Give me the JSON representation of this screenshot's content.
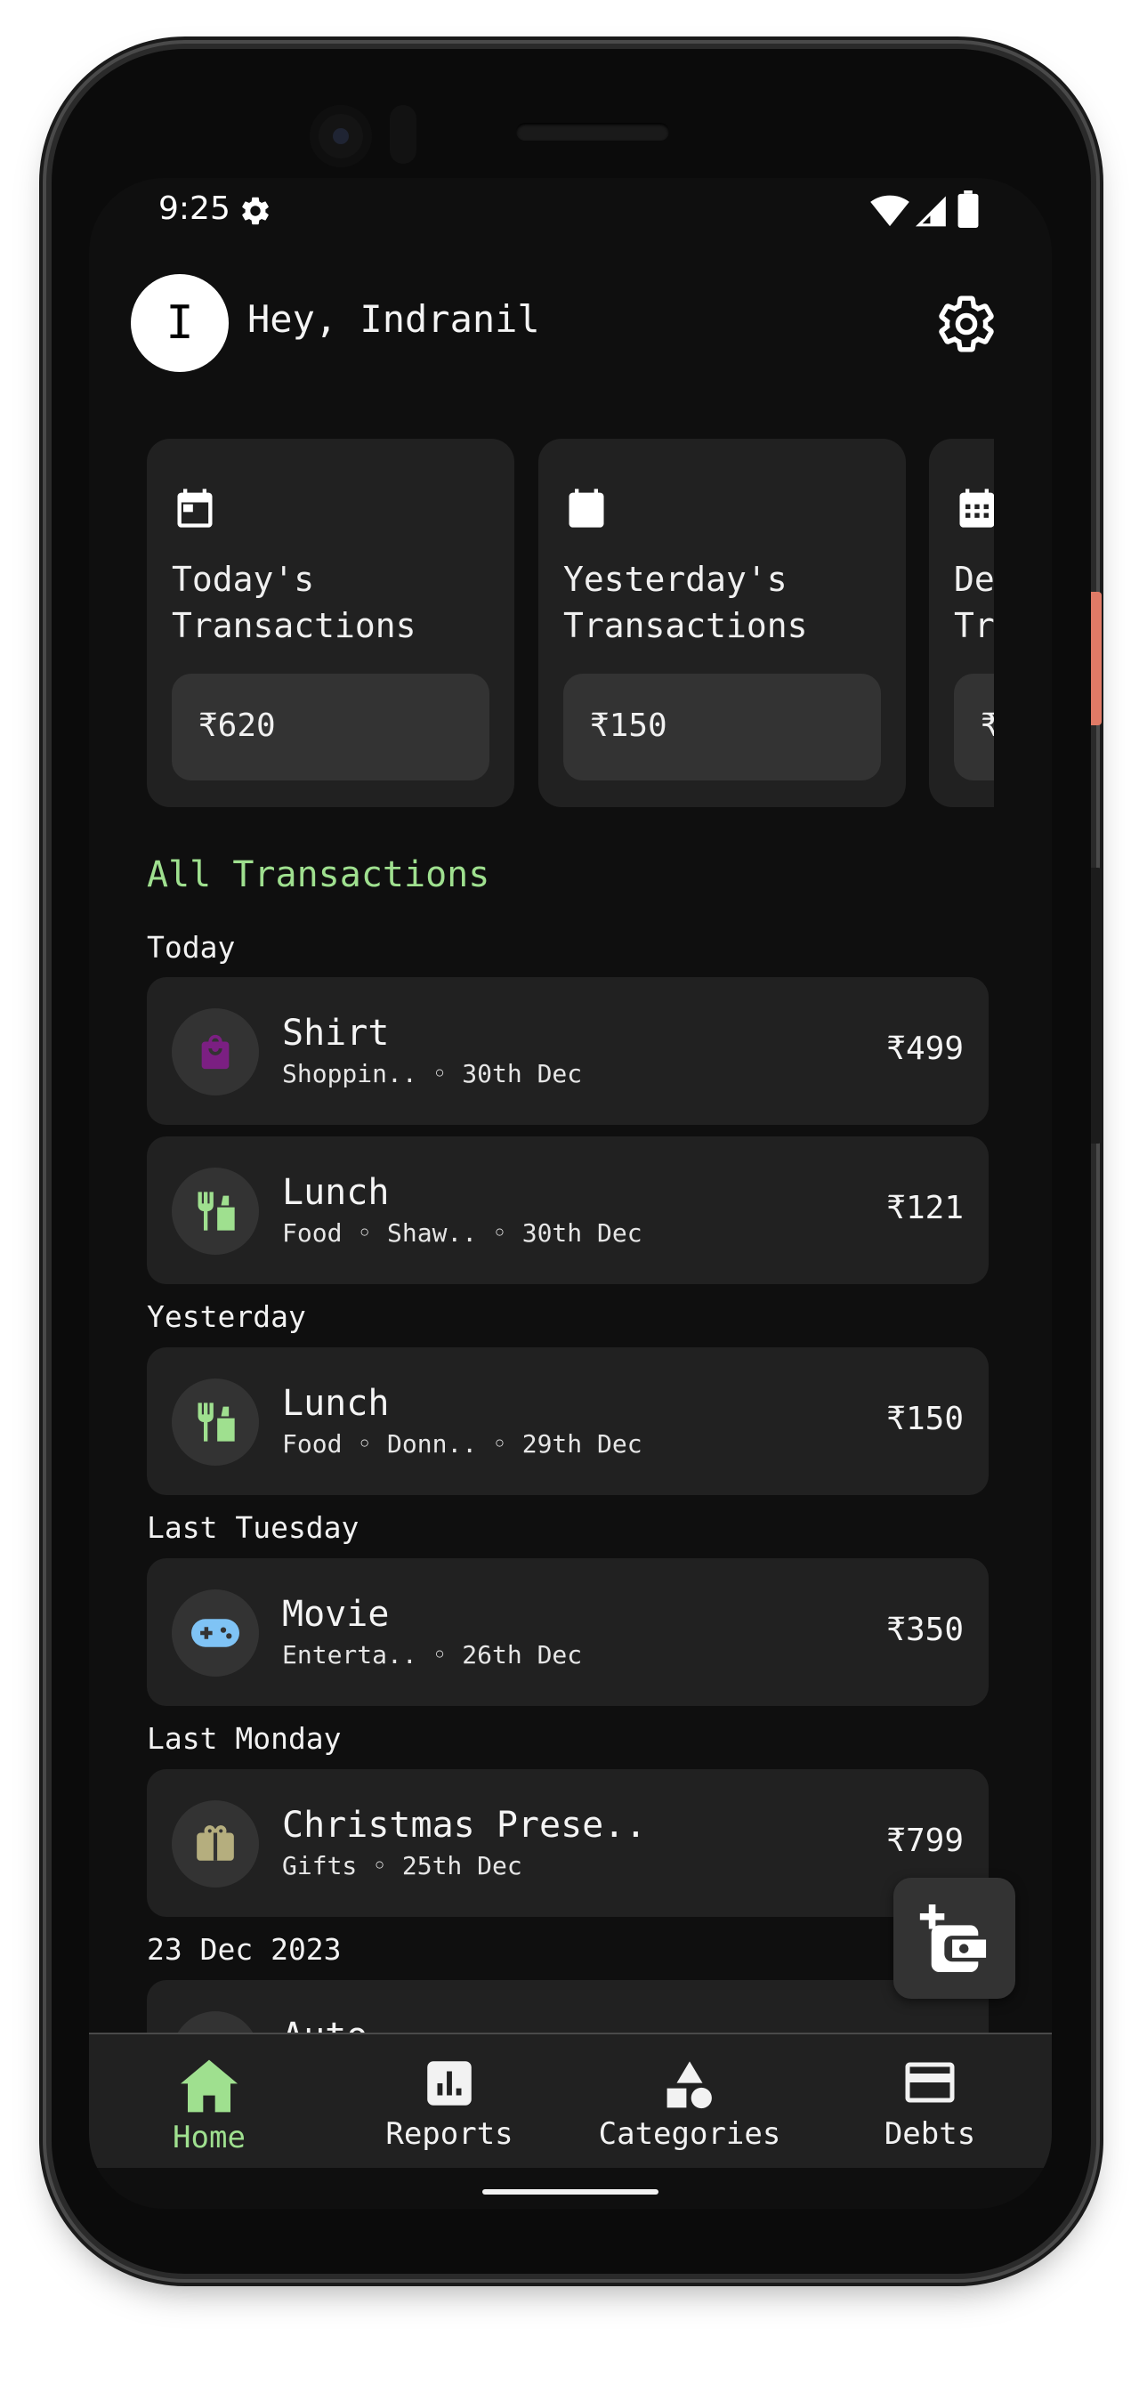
{
  "status_bar": {
    "time": "9:25"
  },
  "header": {
    "avatar_initial": "I",
    "greeting": "Hey, Indranil"
  },
  "summary_cards": [
    {
      "title": "Today's\nTransactions",
      "amount": "₹620"
    },
    {
      "title": "Yesterday's\nTransactions",
      "amount": "₹150"
    },
    {
      "title": "Dec\nTransactions",
      "amount": "₹"
    }
  ],
  "section_title": "All Transactions",
  "groups": [
    {
      "label": "Today",
      "transactions": [
        {
          "name": "Shirt",
          "meta": "Shoppin.. ◦ 30th Dec",
          "amount": "₹499",
          "icon": "shopping-bag-icon",
          "icon_color": "#7b1f82"
        },
        {
          "name": "Lunch",
          "meta": "Food ◦ Shaw.. ◦ 30th Dec",
          "amount": "₹121",
          "icon": "restaurant-icon",
          "icon_color": "#9fe08f"
        }
      ]
    },
    {
      "label": "Yesterday",
      "transactions": [
        {
          "name": "Lunch",
          "meta": "Food ◦ Donn.. ◦ 29th Dec",
          "amount": "₹150",
          "icon": "restaurant-icon",
          "icon_color": "#9fe08f"
        }
      ]
    },
    {
      "label": "Last Tuesday",
      "transactions": [
        {
          "name": "Movie",
          "meta": "Enterta.. ◦ 26th Dec",
          "amount": "₹350",
          "icon": "gamepad-icon",
          "icon_color": "#7fc3f5"
        }
      ]
    },
    {
      "label": "Last Monday",
      "transactions": [
        {
          "name": "Christmas Prese..",
          "meta": "Gifts ◦ 25th Dec",
          "amount": "₹799",
          "icon": "gift-icon",
          "icon_color": "#b5ae7e"
        }
      ]
    },
    {
      "label": "23 Dec 2023",
      "transactions": [
        {
          "name": "Auto",
          "meta": "",
          "amount": "",
          "icon": "circle-icon",
          "icon_color": "#e0c84a"
        }
      ]
    }
  ],
  "bottom_nav": [
    {
      "label": "Home",
      "icon": "home-icon",
      "active": true
    },
    {
      "label": "Reports",
      "icon": "reports-icon",
      "active": false
    },
    {
      "label": "Categories",
      "icon": "categories-icon",
      "active": false
    },
    {
      "label": "Debts",
      "icon": "credit-card-icon",
      "active": false
    }
  ],
  "colors": {
    "accent": "#9fe08f",
    "card": "#212121",
    "background": "#0f0f0f"
  }
}
